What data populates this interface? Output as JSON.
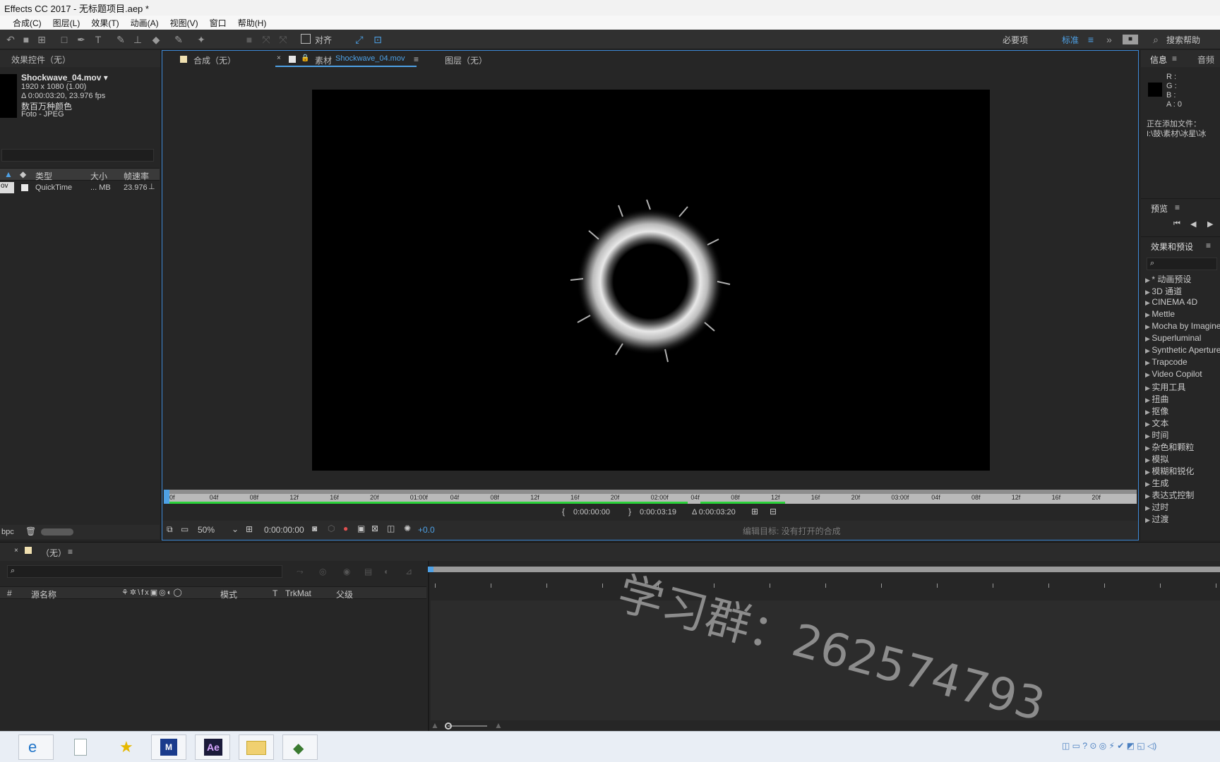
{
  "window": {
    "title": "Effects CC 2017 - 无标题项目.aep *"
  },
  "menu": [
    "合成(C)",
    "图层(L)",
    "效果(T)",
    "动画(A)",
    "视图(V)",
    "窗口",
    "帮助(H)"
  ],
  "toolbar": {
    "align_label": "对齐",
    "workspace_essentials": "必要项",
    "workspace_standard": "标准",
    "search_help": "搜索帮助"
  },
  "effect_controls": {
    "tab": "效果控件（无）",
    "file_name": "Shockwave_04.mov",
    "resolution": "1920 x 1080 (1.00)",
    "duration_fps": "Δ 0:00:03:20, 23.976 fps",
    "colors": "数百万种颜色",
    "codec": "Foto - JPEG",
    "columns": [
      "类型",
      "大小",
      "帧速率"
    ],
    "row": {
      "type": "QuickTime",
      "size": "... MB",
      "fps": "23.976"
    },
    "bpc": "bpc"
  },
  "viewer": {
    "tabs": [
      {
        "label": "合成（无）"
      },
      {
        "prefix": "素材",
        "label": "Shockwave_04.mov"
      },
      {
        "label": "图层（无）"
      }
    ],
    "ruler_labels": [
      "0f",
      "04f",
      "08f",
      "12f",
      "16f",
      "20f",
      "01:00f",
      "04f",
      "08f",
      "12f",
      "16f",
      "20f",
      "02:00f",
      "04f",
      "08f",
      "12f",
      "16f",
      "20f",
      "03:00f",
      "04f",
      "08f",
      "12f",
      "16f",
      "20f"
    ],
    "in_point": "0:00:00:00",
    "out_point": "0:00:03:19",
    "duration": "Δ 0:00:03:20",
    "zoom": "50%",
    "current_time": "0:00:00:00",
    "exposure": "+0.0",
    "edit_target": "编辑目标: 没有打开的合成"
  },
  "info_panel": {
    "tabs": [
      "信息",
      "音频"
    ],
    "channels": [
      "R :",
      "G :",
      "B :",
      "A : 0"
    ],
    "status": "正在添加文件：",
    "path": "I:\\鼓\\素材\\冰星\\冰"
  },
  "preview_panel": {
    "title": "预览"
  },
  "effects_presets": {
    "title": "效果和预设",
    "items": [
      "* 动画预设",
      "3D 通道",
      "CINEMA 4D",
      "Mettle",
      "Mocha by Imagineer",
      "Superluminal",
      "Synthetic Aperture",
      "Trapcode",
      "Video Copilot",
      "实用工具",
      "扭曲",
      "抠像",
      "文本",
      "时间",
      "杂色和颗粒",
      "模拟",
      "模糊和锐化",
      "生成",
      "表达式控制",
      "过时",
      "过渡"
    ]
  },
  "timeline": {
    "tab": "（无）",
    "columns": [
      "#",
      "源名称",
      "模式",
      "T",
      "TrkMat",
      "父级"
    ]
  },
  "watermark": "学习群：262574793",
  "colors": {
    "accent": "#4ea1e6",
    "work_area": "#2bd23a"
  }
}
